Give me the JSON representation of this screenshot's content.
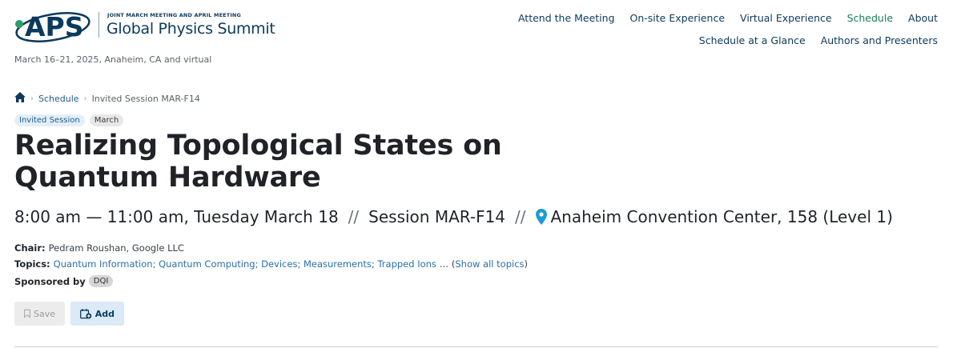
{
  "header": {
    "logo_mark": "APS",
    "logo_small_text": "JOINT MARCH MEETING AND APRIL MEETING",
    "logo_title": "Global Physics Summit",
    "dates": "March 16–21, 2025, Anaheim, CA and virtual",
    "nav_primary": [
      "Attend the Meeting",
      "On-site Experience",
      "Virtual Experience",
      "Schedule",
      "About"
    ],
    "nav_secondary": [
      "Schedule at a Glance",
      "Authors and Presenters"
    ],
    "active_nav": "Schedule"
  },
  "breadcrumb": {
    "home_icon": "home-icon",
    "items": [
      "Schedule"
    ],
    "current": "Invited Session MAR-F14"
  },
  "badges": {
    "type": "Invited Session",
    "meeting": "March"
  },
  "session": {
    "title": "Realizing Topological States on Quantum Hardware",
    "time": "8:00 am — 11:00 am, Tuesday March 18",
    "separator": "//",
    "code": "Session MAR-F14",
    "location": "Anaheim Convention Center, 158 (Level 1)",
    "chair_label": "Chair:",
    "chair": "Pedram Roushan, Google LLC",
    "topics_label": "Topics:",
    "topics": [
      "Quantum Information",
      "Quantum Computing",
      "Devices",
      "Measurements",
      "Trapped Ions"
    ],
    "topics_more": "...",
    "show_all": "Show all topics",
    "sponsored_label": "Sponsored by",
    "sponsor": "DQI"
  },
  "actions": {
    "save_label": "Save",
    "add_label": "Add"
  },
  "colors": {
    "brand": "#0b3a5d",
    "accent": "#18805a",
    "logo_dot": "#2aa06a",
    "link": "#2a6fa8",
    "pin": "#1c9bd6"
  }
}
